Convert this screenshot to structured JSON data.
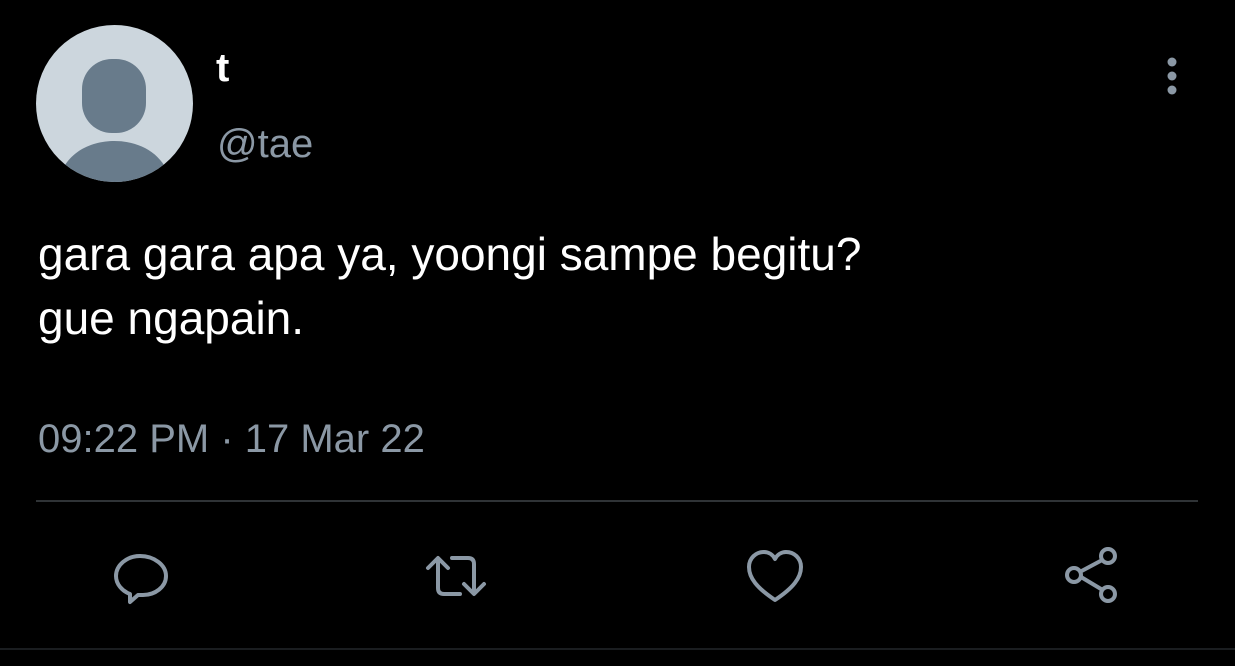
{
  "author": {
    "display_name": "t",
    "handle": "@tae",
    "avatar_icon": "default-profile-silhouette"
  },
  "tweet": {
    "text": "gara gara apa ya, yoongi sampe begitu?\ngue ngapain.",
    "timestamp": "09:22 PM · 17 Mar 22"
  },
  "actions": [
    {
      "name": "reply",
      "icon": "speech-bubble-icon"
    },
    {
      "name": "retweet",
      "icon": "retweet-arrows-icon"
    },
    {
      "name": "like",
      "icon": "heart-icon"
    },
    {
      "name": "share",
      "icon": "share-nodes-icon"
    }
  ],
  "colors": {
    "background": "#000000",
    "text_primary": "#ffffff",
    "text_secondary": "#8b98a5",
    "icon": "#8b98a5",
    "divider": "#2f3336",
    "avatar_bg": "#ccd6dd",
    "avatar_figure": "#687b8b"
  }
}
